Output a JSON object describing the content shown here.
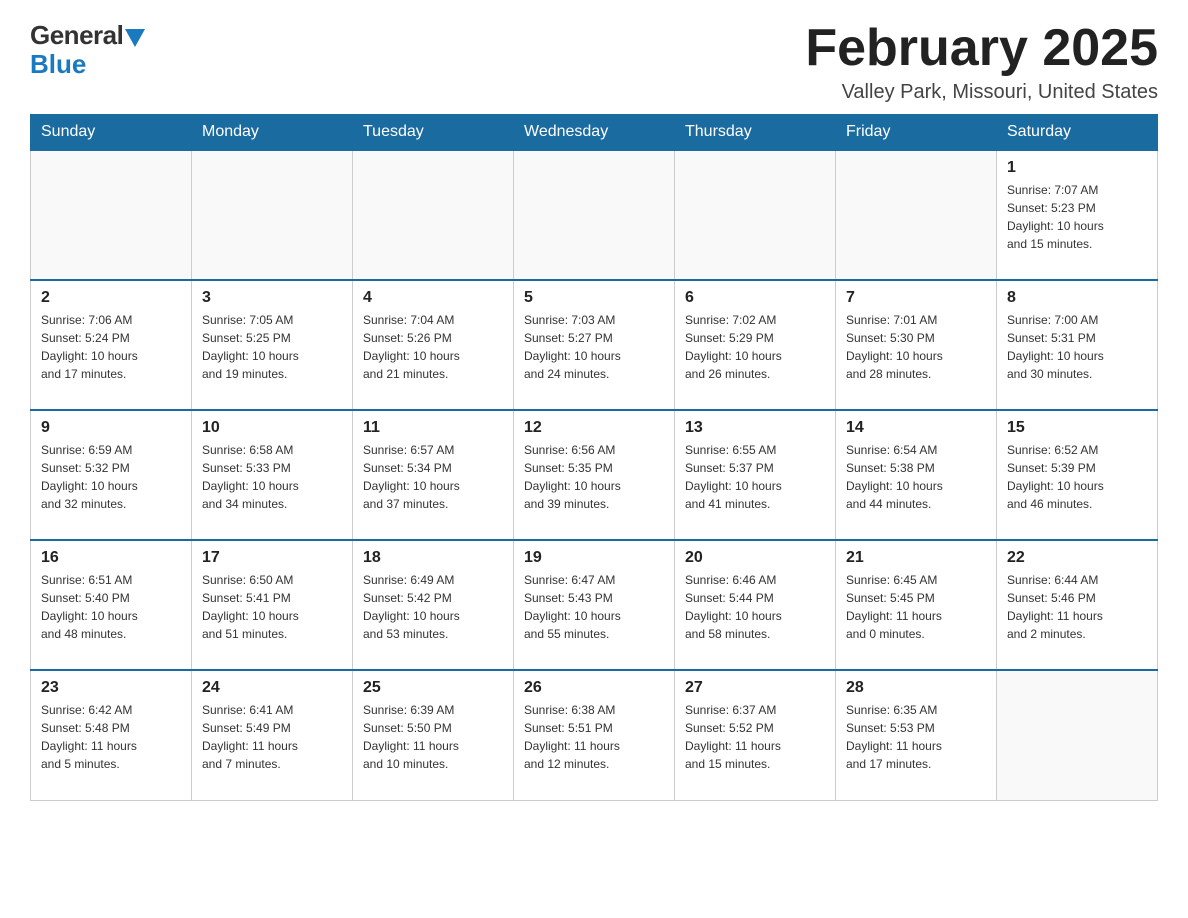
{
  "header": {
    "logo_general": "General",
    "logo_blue": "Blue",
    "month_title": "February 2025",
    "location": "Valley Park, Missouri, United States"
  },
  "days_of_week": [
    "Sunday",
    "Monday",
    "Tuesday",
    "Wednesday",
    "Thursday",
    "Friday",
    "Saturday"
  ],
  "weeks": [
    {
      "days": [
        {
          "number": "",
          "info": "",
          "empty": true
        },
        {
          "number": "",
          "info": "",
          "empty": true
        },
        {
          "number": "",
          "info": "",
          "empty": true
        },
        {
          "number": "",
          "info": "",
          "empty": true
        },
        {
          "number": "",
          "info": "",
          "empty": true
        },
        {
          "number": "",
          "info": "",
          "empty": true
        },
        {
          "number": "1",
          "info": "Sunrise: 7:07 AM\nSunset: 5:23 PM\nDaylight: 10 hours\nand 15 minutes.",
          "empty": false
        }
      ]
    },
    {
      "days": [
        {
          "number": "2",
          "info": "Sunrise: 7:06 AM\nSunset: 5:24 PM\nDaylight: 10 hours\nand 17 minutes.",
          "empty": false
        },
        {
          "number": "3",
          "info": "Sunrise: 7:05 AM\nSunset: 5:25 PM\nDaylight: 10 hours\nand 19 minutes.",
          "empty": false
        },
        {
          "number": "4",
          "info": "Sunrise: 7:04 AM\nSunset: 5:26 PM\nDaylight: 10 hours\nand 21 minutes.",
          "empty": false
        },
        {
          "number": "5",
          "info": "Sunrise: 7:03 AM\nSunset: 5:27 PM\nDaylight: 10 hours\nand 24 minutes.",
          "empty": false
        },
        {
          "number": "6",
          "info": "Sunrise: 7:02 AM\nSunset: 5:29 PM\nDaylight: 10 hours\nand 26 minutes.",
          "empty": false
        },
        {
          "number": "7",
          "info": "Sunrise: 7:01 AM\nSunset: 5:30 PM\nDaylight: 10 hours\nand 28 minutes.",
          "empty": false
        },
        {
          "number": "8",
          "info": "Sunrise: 7:00 AM\nSunset: 5:31 PM\nDaylight: 10 hours\nand 30 minutes.",
          "empty": false
        }
      ]
    },
    {
      "days": [
        {
          "number": "9",
          "info": "Sunrise: 6:59 AM\nSunset: 5:32 PM\nDaylight: 10 hours\nand 32 minutes.",
          "empty": false
        },
        {
          "number": "10",
          "info": "Sunrise: 6:58 AM\nSunset: 5:33 PM\nDaylight: 10 hours\nand 34 minutes.",
          "empty": false
        },
        {
          "number": "11",
          "info": "Sunrise: 6:57 AM\nSunset: 5:34 PM\nDaylight: 10 hours\nand 37 minutes.",
          "empty": false
        },
        {
          "number": "12",
          "info": "Sunrise: 6:56 AM\nSunset: 5:35 PM\nDaylight: 10 hours\nand 39 minutes.",
          "empty": false
        },
        {
          "number": "13",
          "info": "Sunrise: 6:55 AM\nSunset: 5:37 PM\nDaylight: 10 hours\nand 41 minutes.",
          "empty": false
        },
        {
          "number": "14",
          "info": "Sunrise: 6:54 AM\nSunset: 5:38 PM\nDaylight: 10 hours\nand 44 minutes.",
          "empty": false
        },
        {
          "number": "15",
          "info": "Sunrise: 6:52 AM\nSunset: 5:39 PM\nDaylight: 10 hours\nand 46 minutes.",
          "empty": false
        }
      ]
    },
    {
      "days": [
        {
          "number": "16",
          "info": "Sunrise: 6:51 AM\nSunset: 5:40 PM\nDaylight: 10 hours\nand 48 minutes.",
          "empty": false
        },
        {
          "number": "17",
          "info": "Sunrise: 6:50 AM\nSunset: 5:41 PM\nDaylight: 10 hours\nand 51 minutes.",
          "empty": false
        },
        {
          "number": "18",
          "info": "Sunrise: 6:49 AM\nSunset: 5:42 PM\nDaylight: 10 hours\nand 53 minutes.",
          "empty": false
        },
        {
          "number": "19",
          "info": "Sunrise: 6:47 AM\nSunset: 5:43 PM\nDaylight: 10 hours\nand 55 minutes.",
          "empty": false
        },
        {
          "number": "20",
          "info": "Sunrise: 6:46 AM\nSunset: 5:44 PM\nDaylight: 10 hours\nand 58 minutes.",
          "empty": false
        },
        {
          "number": "21",
          "info": "Sunrise: 6:45 AM\nSunset: 5:45 PM\nDaylight: 11 hours\nand 0 minutes.",
          "empty": false
        },
        {
          "number": "22",
          "info": "Sunrise: 6:44 AM\nSunset: 5:46 PM\nDaylight: 11 hours\nand 2 minutes.",
          "empty": false
        }
      ]
    },
    {
      "days": [
        {
          "number": "23",
          "info": "Sunrise: 6:42 AM\nSunset: 5:48 PM\nDaylight: 11 hours\nand 5 minutes.",
          "empty": false
        },
        {
          "number": "24",
          "info": "Sunrise: 6:41 AM\nSunset: 5:49 PM\nDaylight: 11 hours\nand 7 minutes.",
          "empty": false
        },
        {
          "number": "25",
          "info": "Sunrise: 6:39 AM\nSunset: 5:50 PM\nDaylight: 11 hours\nand 10 minutes.",
          "empty": false
        },
        {
          "number": "26",
          "info": "Sunrise: 6:38 AM\nSunset: 5:51 PM\nDaylight: 11 hours\nand 12 minutes.",
          "empty": false
        },
        {
          "number": "27",
          "info": "Sunrise: 6:37 AM\nSunset: 5:52 PM\nDaylight: 11 hours\nand 15 minutes.",
          "empty": false
        },
        {
          "number": "28",
          "info": "Sunrise: 6:35 AM\nSunset: 5:53 PM\nDaylight: 11 hours\nand 17 minutes.",
          "empty": false
        },
        {
          "number": "",
          "info": "",
          "empty": true
        }
      ]
    }
  ]
}
